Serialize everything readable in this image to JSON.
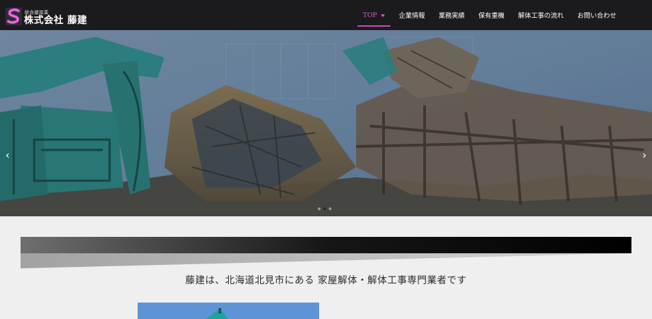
{
  "header": {
    "logo": {
      "small_text": "総合建設業",
      "company_name": "株式会社 藤建"
    },
    "nav": [
      {
        "label": "TOP",
        "has_dropdown": true,
        "active": true
      },
      {
        "label": "企業情報"
      },
      {
        "label": "業務実績"
      },
      {
        "label": "保有重機"
      },
      {
        "label": "解体工事の流れ"
      },
      {
        "label": "お問い合わせ"
      }
    ]
  },
  "slider": {
    "prev_icon": "‹",
    "next_icon": "›",
    "slide_count": 3,
    "active_slide": 2
  },
  "main": {
    "tagline": "藤建は、北海道北見市にある 家屋解体・解体工事専門業者です"
  },
  "colors": {
    "header_bg": "#1b1b1d",
    "nav_active": "#e25ad6",
    "page_bg": "#efefef"
  }
}
